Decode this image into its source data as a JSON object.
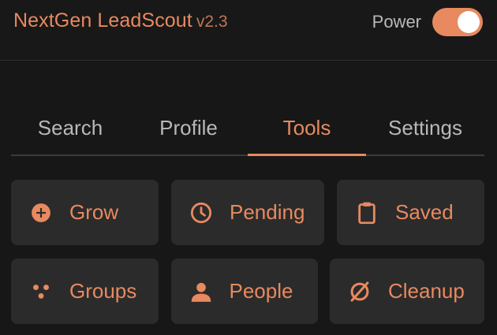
{
  "header": {
    "brand_name": "NextGen LeadScout",
    "version": "v2.3",
    "power_label": "Power",
    "power_on": true
  },
  "tabs": [
    {
      "label": "Search",
      "active": false
    },
    {
      "label": "Profile",
      "active": false
    },
    {
      "label": "Tools",
      "active": true
    },
    {
      "label": "Settings",
      "active": false
    }
  ],
  "tools": {
    "grow": {
      "label": "Grow",
      "icon": "plus-circle-icon"
    },
    "pending": {
      "label": "Pending",
      "icon": "clock-icon"
    },
    "saved": {
      "label": "Saved",
      "icon": "clipboard-icon"
    },
    "groups": {
      "label": "Groups",
      "icon": "groups-icon"
    },
    "people": {
      "label": "People",
      "icon": "person-icon"
    },
    "cleanup": {
      "label": "Cleanup",
      "icon": "empty-set-icon"
    }
  },
  "colors": {
    "accent": "#e8895f",
    "background": "#171717",
    "button_bg": "#2b2b2b",
    "tab_inactive": "#b8b8b8"
  }
}
